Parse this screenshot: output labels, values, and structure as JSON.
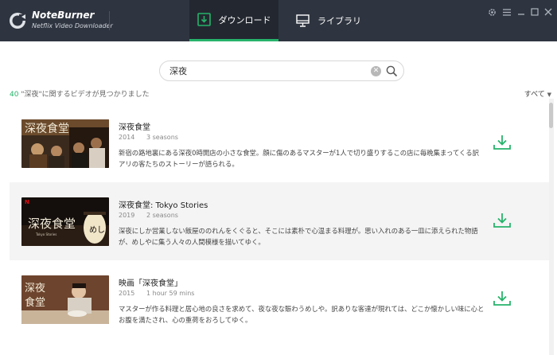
{
  "app": {
    "brand_title": "NoteBurner",
    "brand_subtitle": "Netflix Video Downloader",
    "tabs": [
      {
        "label": "ダウンロード",
        "icon": "download-icon",
        "active": true
      },
      {
        "label": "ライブラリ",
        "icon": "monitor-icon",
        "active": false
      }
    ],
    "window_controls": [
      "gear-icon",
      "menu-icon",
      "minimize-icon",
      "maximize-icon",
      "close-icon"
    ]
  },
  "search": {
    "value": "深夜",
    "placeholder": ""
  },
  "results": {
    "count": "40",
    "text": " \"深夜\"に関するビデオが見つかりました",
    "sort_label": "すべて"
  },
  "items": [
    {
      "title": "深夜食堂",
      "year": "2014",
      "meta": "3 seasons",
      "description": "新宿の路地裏にある深夜0時開店の小さな食堂。顔に傷のあるマスターが1人で切り盛りするこの店に毎晩集まってくる訳アリの客たちのストーリーが語られる。"
    },
    {
      "title": "深夜食堂: Tokyo Stories",
      "year": "2019",
      "meta": "2 seasons",
      "description": "深夜にしか営業しない飯屋ののれんをくぐると、そこには素朴で心温まる料理が。思い入れのある一皿に添えられた物語が、めしやに集う人々の人間模様を描いてゆく。"
    },
    {
      "title": "映画「深夜食堂」",
      "year": "2015",
      "meta": "1 hour 59 mins",
      "description": "マスターが作る料理と居心地の良さを求めて、夜な夜な賑わうめしや。訳ありな客達が現れては、どこか懐かしい味に心とお腹を満たされ、心の重荷をおろしてゆく。"
    }
  ],
  "colors": {
    "titlebar": "#2f3540",
    "accent": "#26b36a"
  }
}
